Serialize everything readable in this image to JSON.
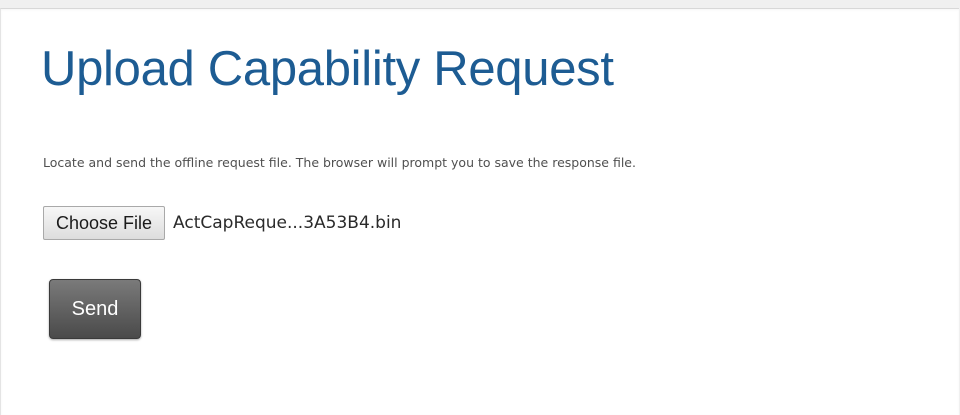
{
  "page": {
    "title": "Upload Capability Request",
    "instructions": "Locate and send the offline request file. The browser will prompt you to save the response file."
  },
  "file_input": {
    "button_label": "Choose File",
    "selected_file": "ActCapReque...3A53B4.bin"
  },
  "actions": {
    "send_label": "Send"
  },
  "colors": {
    "title": "#1d5c93",
    "send_button": "#5a5a5a"
  }
}
